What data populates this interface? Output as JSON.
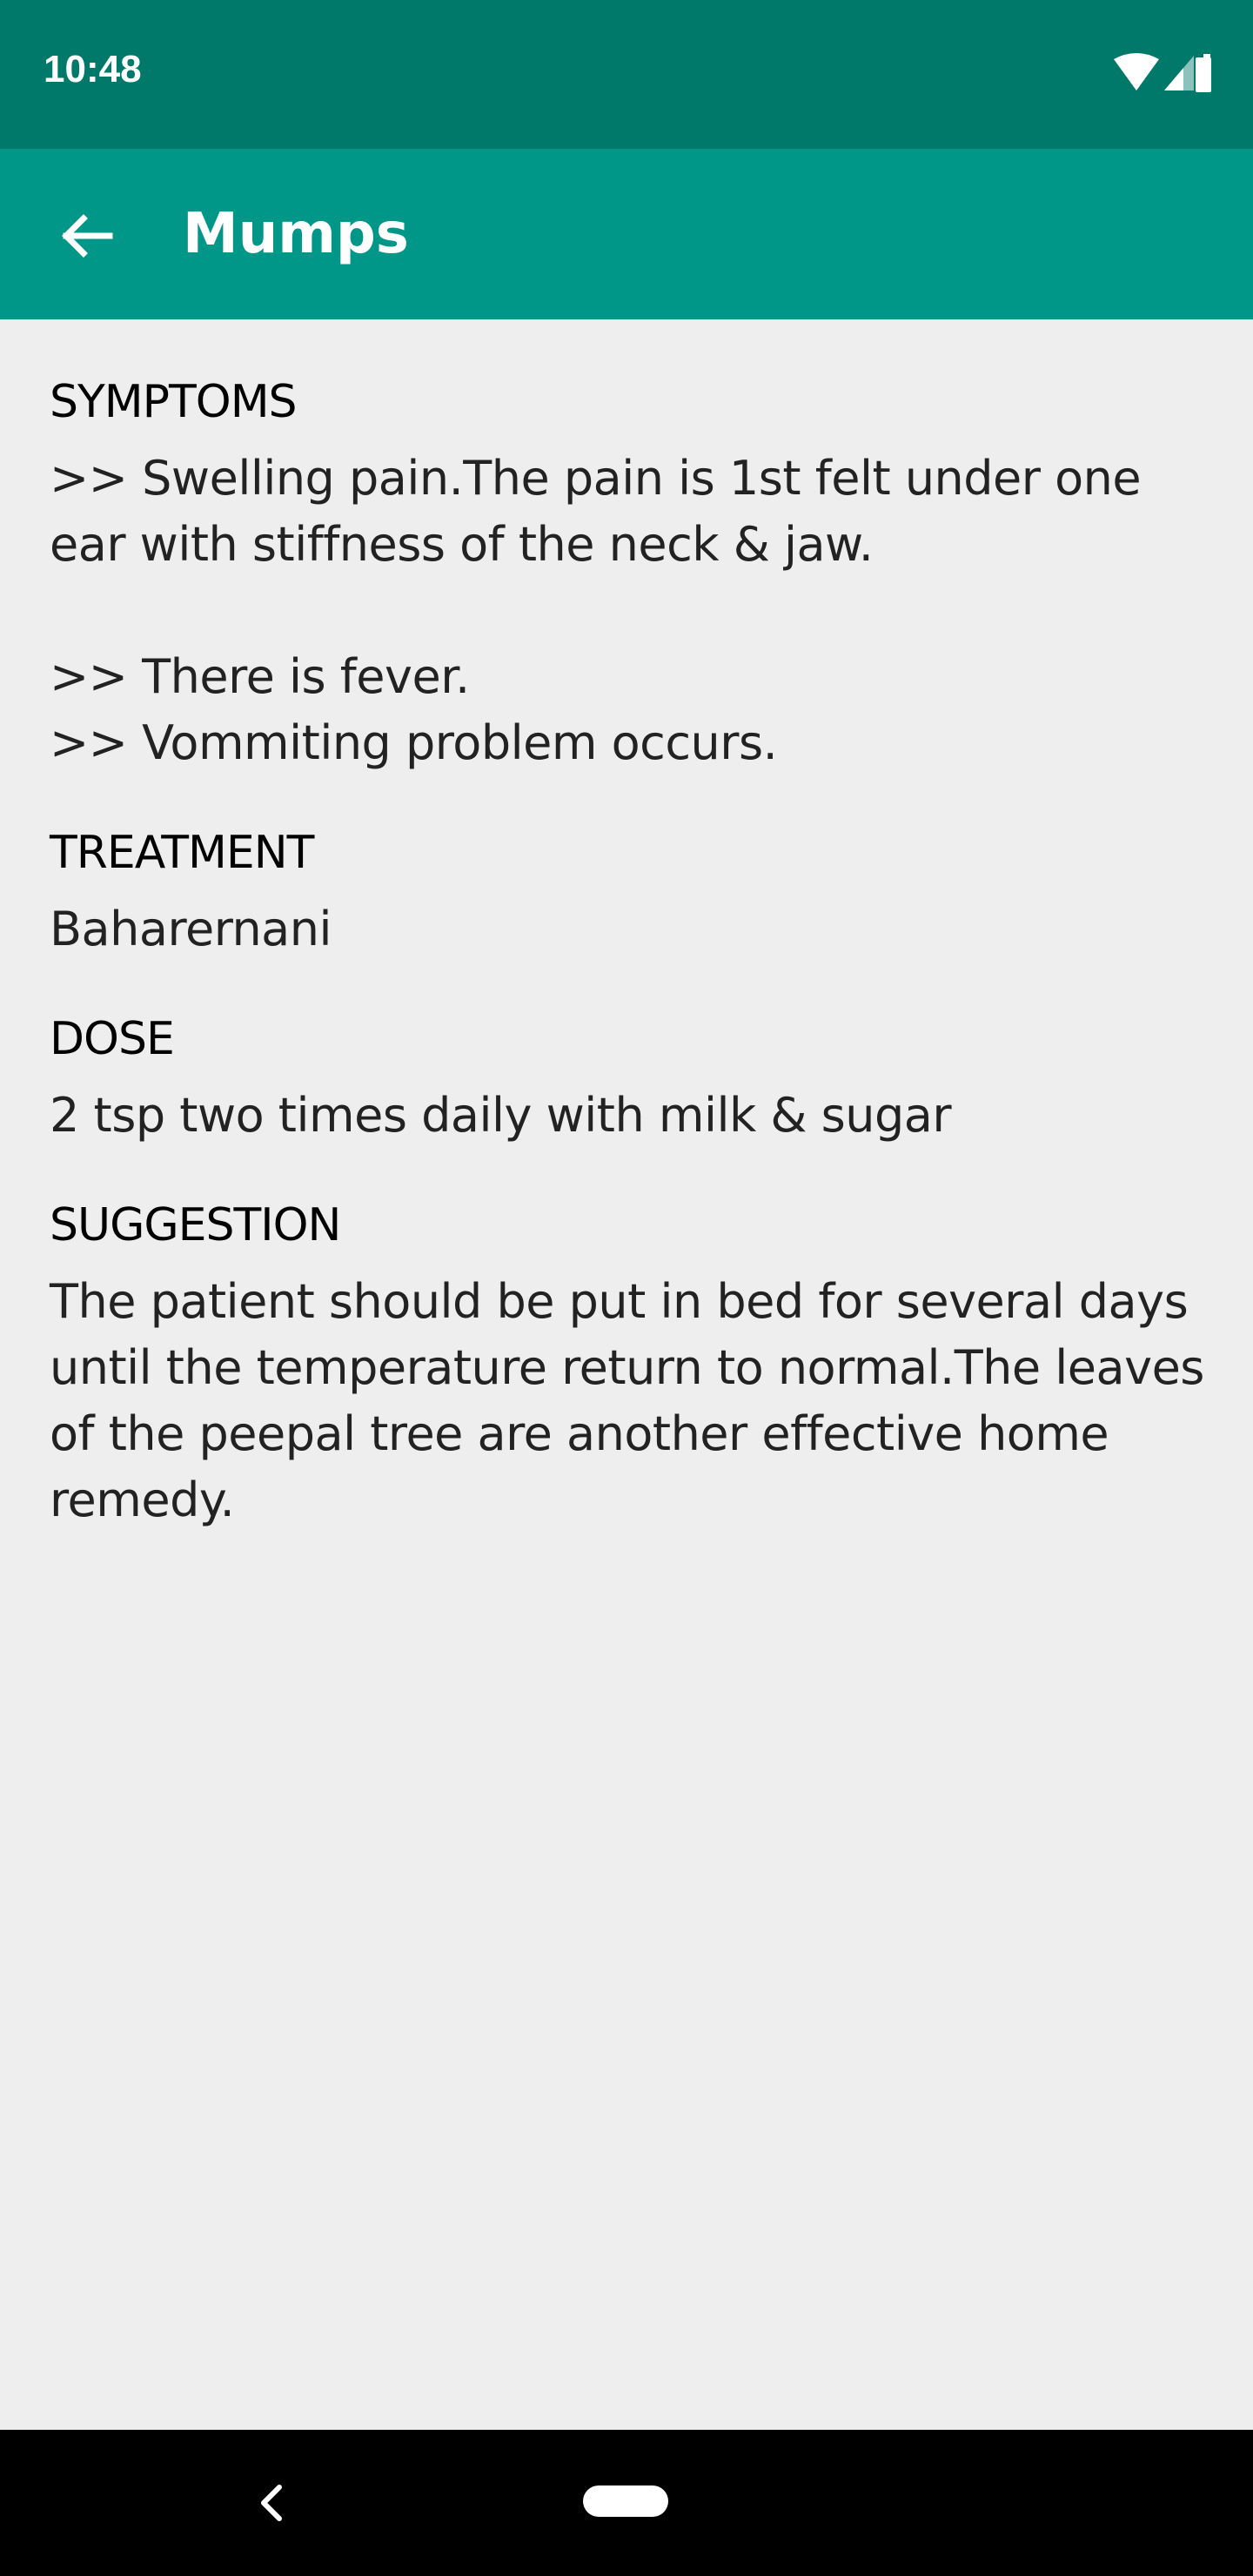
{
  "status_bar": {
    "time": "10:48",
    "icons": [
      "wifi-icon",
      "cellular-signal-icon",
      "battery-icon"
    ]
  },
  "app_bar": {
    "back_icon": "arrow-left-icon",
    "title": "Mumps"
  },
  "sections": [
    {
      "heading": "SYMPTOMS",
      "body": ">> Swelling pain.The pain is 1st felt under one ear with stiffness of the neck & jaw.\n\n>> There is fever.\n>> Vommiting problem occurs."
    },
    {
      "heading": "TREATMENT",
      "body": "Baharernani"
    },
    {
      "heading": "DOSE",
      "body": "2 tsp two times daily with milk & sugar"
    },
    {
      "heading": "SUGGESTION",
      "body": "The patient should be put in bed for several days until the temperature return to normal.The leaves of the peepal tree are another effective home remedy."
    }
  ],
  "nav_bar": {
    "back_icon": "chevron-left-icon",
    "home_icon": "home-pill-icon"
  },
  "colors": {
    "status_bar": "#00796b",
    "app_bar": "#009688",
    "background": "#eeeeee",
    "nav_bar": "#000000"
  }
}
